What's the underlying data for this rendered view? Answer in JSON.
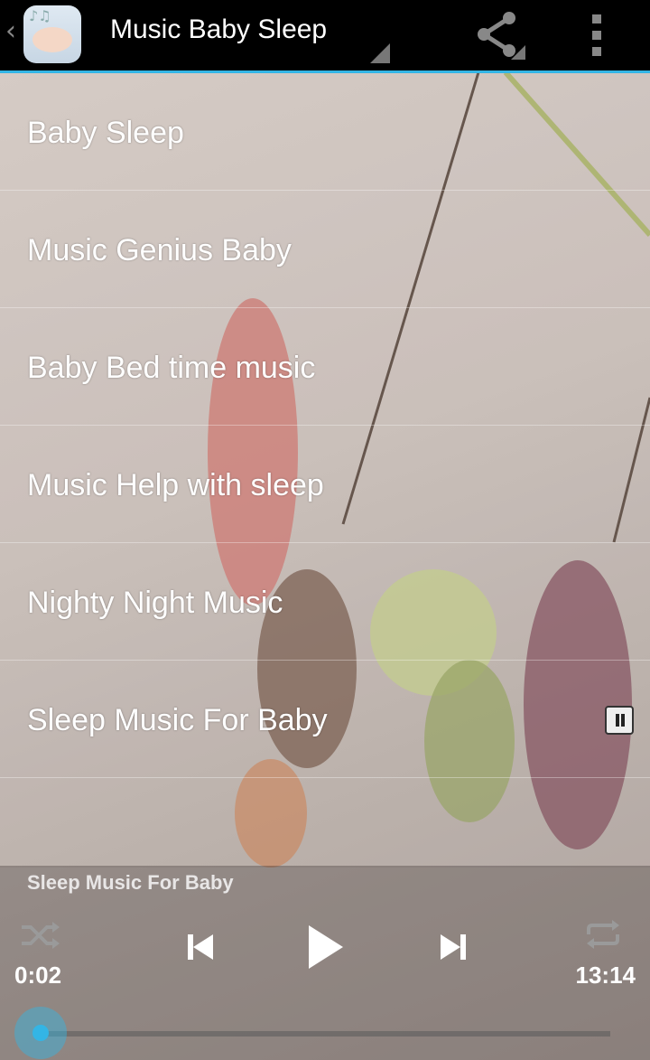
{
  "app": {
    "title": "Music Baby Sleep",
    "icon": "baby-sleeping-app-icon",
    "accent": "#33b5e5",
    "bar_color": "#000000"
  },
  "actions": {
    "share_icon": "share-icon",
    "overflow_icon": "overflow-menu-icon"
  },
  "list": {
    "items": [
      {
        "label": "Baby Sleep"
      },
      {
        "label": "Music Genius Baby"
      },
      {
        "label": "Baby Bed time music"
      },
      {
        "label": "Music Help with sleep"
      },
      {
        "label": "Nighty Night Music"
      },
      {
        "label": "Sleep Music For Baby",
        "playing": true,
        "status_icon": "pause-icon"
      }
    ]
  },
  "player": {
    "now_playing": "Sleep Music For Baby",
    "current_time": "0:02",
    "total_time": "13:14",
    "progress": 0.0025,
    "icons": [
      "shuffle-icon",
      "previous-icon",
      "play-icon",
      "next-icon",
      "repeat-icon"
    ]
  }
}
